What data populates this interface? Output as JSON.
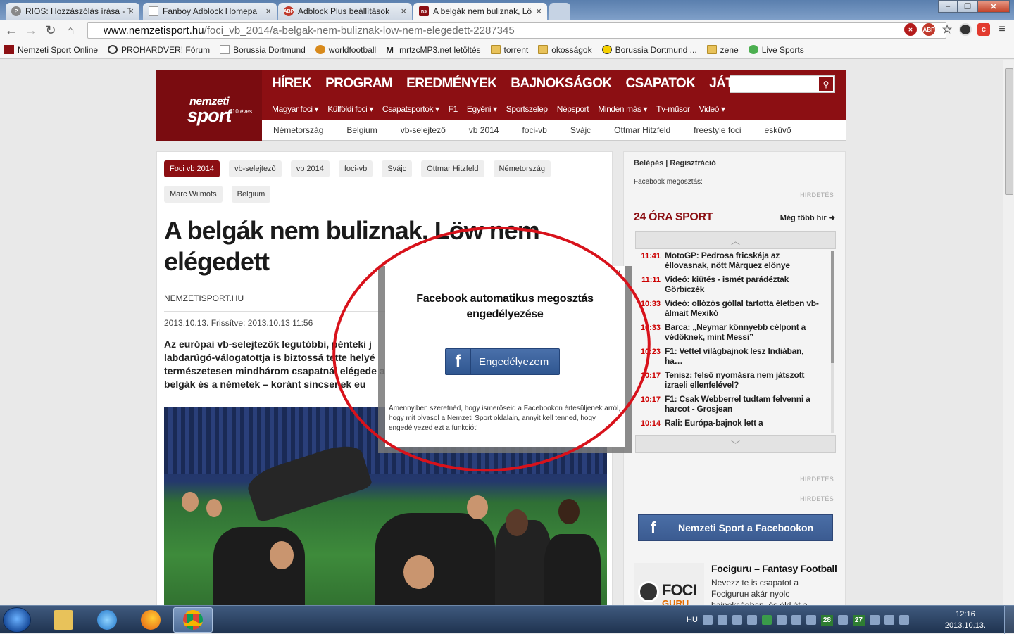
{
  "browser": {
    "tabs": [
      {
        "title": "RIOS: Hozzászólás írása - T",
        "icon": "forum-icon",
        "active": false
      },
      {
        "title": "Fanboy Adblock Homepa",
        "icon": "page-icon",
        "active": false
      },
      {
        "title": "Adblock Plus beállítások",
        "icon": "abp-icon",
        "active": false
      },
      {
        "title": "A belgák nem buliznak, Lö",
        "icon": "ns-icon",
        "active": true
      }
    ],
    "url_domain": "www.nemzetisport.hu",
    "url_path": "/foci_vb_2014/a-belgak-nem-buliznak-low-nem-elegedett-2287345",
    "bookmarks": [
      {
        "label": "Nemzeti Sport Online",
        "icon": "ns-icon"
      },
      {
        "label": "PROHARDVER! Fórum",
        "icon": "ph-icon"
      },
      {
        "label": "Borussia Dortmund",
        "icon": "page-icon"
      },
      {
        "label": "worldfootball",
        "icon": "wf-icon"
      },
      {
        "label": "mrtzcMP3.net letöltés",
        "icon": "m-icon"
      },
      {
        "label": "torrent",
        "icon": "folder-icon"
      },
      {
        "label": "okosságok",
        "icon": "folder-icon"
      },
      {
        "label": "Borussia Dortmund ...",
        "icon": "bvb-icon"
      },
      {
        "label": "zene",
        "icon": "folder-icon"
      },
      {
        "label": "Live Sports",
        "icon": "ls-icon"
      }
    ]
  },
  "site": {
    "logo_line1": "nemzeti",
    "logo_line2": "sport",
    "logo_badge": "110 éves",
    "main_nav": [
      "HÍREK",
      "PROGRAM",
      "EREDMÉNYEK",
      "BAJNOKSÁGOK",
      "CSAPATOK",
      "JÁTÉKOSOK"
    ],
    "sub_nav": [
      "Magyar foci ▾",
      "Külföldi foci ▾",
      "Csapatsportok ▾",
      "F1",
      "Egyéni ▾",
      "Sportszelep",
      "Népsport",
      "Minden más ▾",
      "Tv-műsor",
      "Videó ▾"
    ],
    "tag_nav": [
      "Németország",
      "Belgium",
      "vb-selejtező",
      "vb 2014",
      "foci-vb",
      "Svájc",
      "Ottmar Hitzfeld",
      "freestyle foci",
      "esküvő"
    ]
  },
  "article": {
    "tags": [
      "Foci vb 2014",
      "vb-selejtező",
      "vb 2014",
      "foci-vb",
      "Svájc",
      "Ottmar Hitzfeld",
      "Németország",
      "Marc Wilmots",
      "Belgium"
    ],
    "title": "A belgák nem buliznak, Löw nem elégedett",
    "source": "NEMZETISPORT.HU",
    "date": "2013.10.13. Frissítve: 2013.10.13 11:56",
    "lead": "Az európai vb-selejtezők legutóbbi, pénteki j labdarúgó-válogatottja is biztossá tette helyé természetesen mindhárom csapatnál elégede a belgák és a németek – koránt sincsenek eu"
  },
  "sidebar": {
    "login": "Belépés",
    "register": "Regisztráció",
    "fb_share": "Facebook megosztás:",
    "ad_label": "HIRDETÉS",
    "section_title": "24 ÓRA SPORT",
    "more": "Még több hír",
    "news": [
      {
        "time": "11:41",
        "title": "MotoGP: Pedrosa fricskája az éllovasnak, nőtt Márquez előnye"
      },
      {
        "time": "11:11",
        "title": "Videó: kiütés - ismét parádéztak Görbiczék"
      },
      {
        "time": "10:33",
        "title": "Videó: ollózós góllal tartotta életben vb-álmait Mexikó"
      },
      {
        "time": "10:33",
        "title": "Barca: „Neymar könnyebb célpont a védőknek, mint Messi”"
      },
      {
        "time": "10:23",
        "title": "F1: Vettel világbajnok lesz Indiában, ha…"
      },
      {
        "time": "10:17",
        "title": "Tenisz: felső nyomásra nem játszott izraeli ellenfelével?"
      },
      {
        "time": "10:17",
        "title": "F1: Csak Webberrel tudtam felvenni a harcot - Grosjean"
      },
      {
        "time": "10:14",
        "title": "Rali: Európa-bajnok lett a"
      }
    ],
    "fb_button": "Nemzeti Sport a Facebookon",
    "foci_title": "Fociguru – Fantasy Football",
    "foci_text": "Nevezz te is csapatot a Fociguruн akár nyolc bajnokságban, és éld át a",
    "foci_logo1": "FOCI",
    "foci_logo2": "GURU"
  },
  "modal": {
    "close": "x",
    "title": "Facebook automatikus megosztás engedélyezése",
    "button": "Engedélyezem",
    "text": "Amennyiben szeretnéd, hogy ismerőseid a Facebookon értesüljenek arról, hogy mit olvasol a Nemzeti Sport oldalain, annyit kell tenned, hogy engedélyezed ezt a funkciót!"
  },
  "taskbar": {
    "lang": "HU",
    "badge1": "28",
    "badge2": "27",
    "time": "12:16",
    "date": "2013.10.13."
  },
  "colors": {
    "brand": "#8c0f13",
    "facebook": "#3b5b91",
    "annotation_ring": "#d8121b"
  }
}
